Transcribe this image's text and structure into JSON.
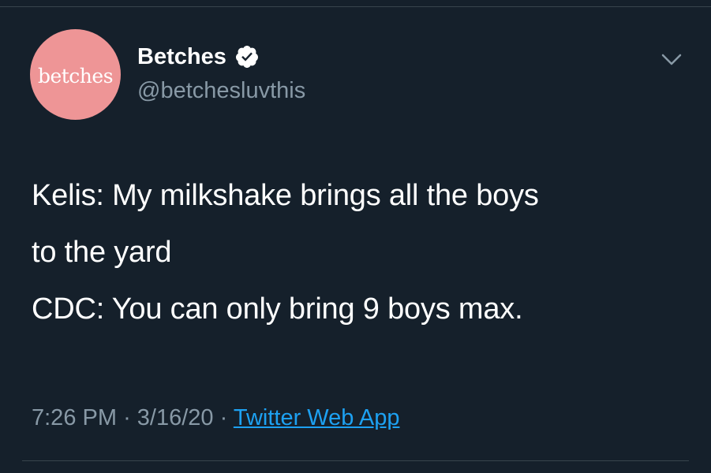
{
  "tweet": {
    "avatar_text": "betches",
    "display_name": "Betches",
    "handle": "@betchesluvthis",
    "text_lines": [
      "Kelis: My milkshake brings all the boys",
      "to the yard",
      "CDC: You can only bring 9 boys max."
    ],
    "time": "7:26 PM",
    "date": "3/16/20",
    "separator": "·",
    "source": "Twitter Web App"
  },
  "icons": {
    "verified": "verified-badge-icon",
    "menu": "chevron-down-icon"
  },
  "colors": {
    "background": "#15202b",
    "avatar": "#ee9596",
    "secondary_text": "#8899a6",
    "link": "#1da1f2",
    "divider": "#38444d"
  }
}
